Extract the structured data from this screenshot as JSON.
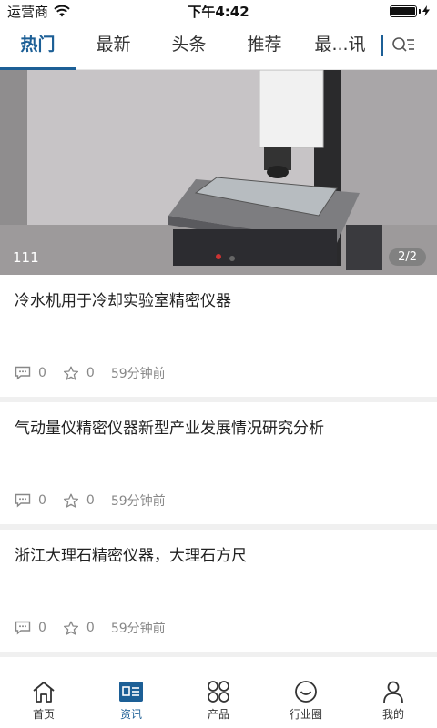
{
  "status_bar": {
    "carrier": "运营商",
    "time": "下午4:42",
    "battery_level": 1.0
  },
  "tabs": [
    {
      "label": "热门",
      "active": true
    },
    {
      "label": "最新",
      "active": false
    },
    {
      "label": "头条",
      "active": false
    },
    {
      "label": "推荐",
      "active": false
    },
    {
      "label": "最...讯",
      "active": false
    }
  ],
  "hero": {
    "caption": "111",
    "pager": "2/2"
  },
  "news": [
    {
      "title": "冷水机用于冷却实验室精密仪器",
      "comments": "0",
      "likes": "0",
      "time": "59分钟前"
    },
    {
      "title": "气动量仪精密仪器新型产业发展情况研究分析",
      "comments": "0",
      "likes": "0",
      "time": "59分钟前"
    },
    {
      "title": "浙江大理石精密仪器，大理石方尺",
      "comments": "0",
      "likes": "0",
      "time": "59分钟前"
    }
  ],
  "bottom_nav": [
    {
      "label": "首页",
      "icon": "home-icon",
      "active": false
    },
    {
      "label": "资讯",
      "icon": "news-icon",
      "active": true
    },
    {
      "label": "产品",
      "icon": "grid-icon",
      "active": false
    },
    {
      "label": "行业圈",
      "icon": "smile-icon",
      "active": false
    },
    {
      "label": "我的",
      "icon": "user-icon",
      "active": false
    }
  ],
  "colors": {
    "accent": "#1c5f96",
    "meta": "#888888",
    "divider": "#f0f0f0"
  }
}
